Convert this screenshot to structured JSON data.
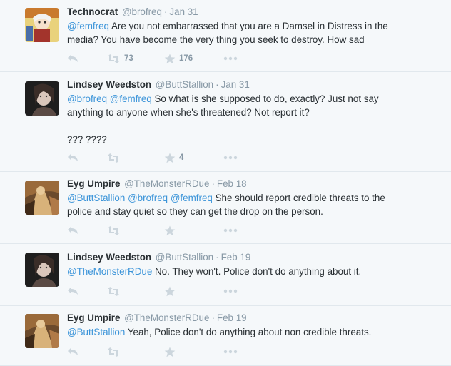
{
  "colors": {
    "background": "#f5f8fa",
    "border": "#e1e8ed",
    "mention": "#3b94d9",
    "meta": "#8899a6",
    "action_icon": "#ccd6dd"
  },
  "tweets": [
    {
      "fullname": "Technocrat",
      "screenname": "@brofreq",
      "time": "Jan 31",
      "avatar_icon": "anime-character-avatar",
      "text": [
        [
          {
            "m": "@femfreq"
          },
          {
            "t": " Are you not embarrassed that you are a Damsel in Distress in the"
          }
        ],
        [
          {
            "t": "media? You have become the very thing you seek to destroy. How sad"
          }
        ]
      ],
      "retweets": "73",
      "favorites": "176"
    },
    {
      "fullname": "Lindsey Weedston",
      "screenname": "@ButtStallion",
      "time": "Jan 31",
      "avatar_icon": "woman-portrait-avatar",
      "text": [
        [
          {
            "m": "@brofreq"
          },
          {
            "t": " "
          },
          {
            "m": "@femfreq"
          },
          {
            "t": " So what is she supposed to do, exactly? Just not say"
          }
        ],
        [
          {
            "t": "anything to anyone when she's threatened? Not report it?"
          }
        ],
        [
          {
            "t": ""
          }
        ],
        [
          {
            "t": "??? ????"
          }
        ]
      ],
      "retweets": "",
      "favorites": "4"
    },
    {
      "fullname": "Eyg Umpire",
      "screenname": "@TheMonsterRDue",
      "time": "Feb 18",
      "avatar_icon": "painting-avatar",
      "text": [
        [
          {
            "m": "@ButtStallion"
          },
          {
            "t": " "
          },
          {
            "m": "@brofreq"
          },
          {
            "t": " "
          },
          {
            "m": "@femfreq"
          },
          {
            "t": " She should report credible threats to the"
          }
        ],
        [
          {
            "t": "police and stay quiet so they can get the drop on the person."
          }
        ]
      ],
      "retweets": "",
      "favorites": ""
    },
    {
      "fullname": "Lindsey Weedston",
      "screenname": "@ButtStallion",
      "time": "Feb 19",
      "avatar_icon": "woman-portrait-avatar",
      "text": [
        [
          {
            "m": "@TheMonsterRDue"
          },
          {
            "t": " No. They won't. Police don't do anything about it."
          }
        ]
      ],
      "retweets": "",
      "favorites": ""
    },
    {
      "fullname": "Eyg Umpire",
      "screenname": "@TheMonsterRDue",
      "time": "Feb 19",
      "avatar_icon": "painting-avatar",
      "text": [
        [
          {
            "m": "@ButtStallion"
          },
          {
            "t": " Yeah, Police don't do anything about non credible threats."
          }
        ]
      ],
      "retweets": "",
      "favorites": ""
    }
  ]
}
